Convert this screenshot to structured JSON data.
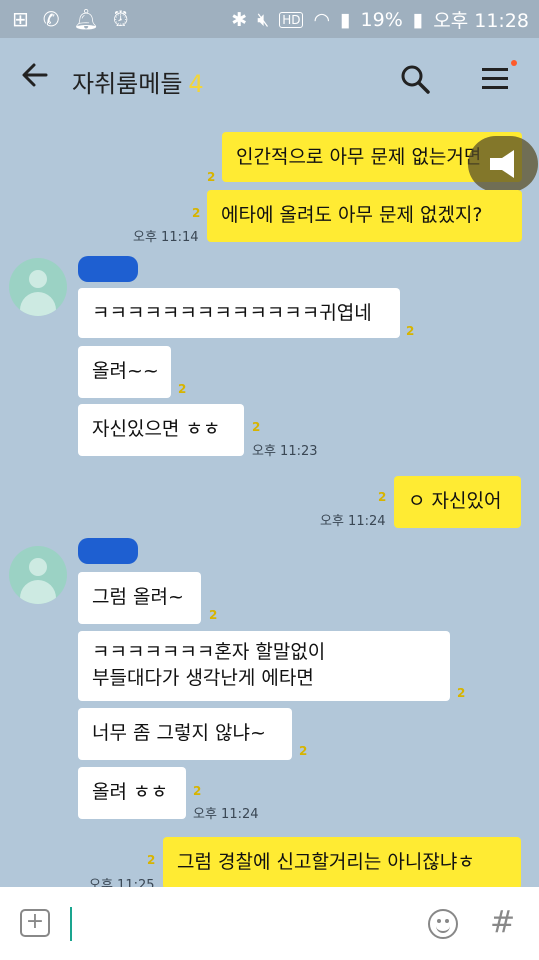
{
  "status_bar": {
    "battery": "19%",
    "time": "오후 11:28",
    "hd_label": "HD"
  },
  "header": {
    "title": "자취룸메들",
    "member_count": "4"
  },
  "messages": [
    {
      "side": "me",
      "text": "인간적으로 아무 문제 없는거면",
      "unread": "2"
    },
    {
      "side": "me",
      "text": "에타에 올려도 아무 문제 없겠지?",
      "unread": "2",
      "time": "오후 11:14"
    },
    {
      "side": "you",
      "text": "ㅋㅋㅋㅋㅋㅋㅋㅋㅋㅋㅋㅋㅋ귀엽네",
      "unread": "2"
    },
    {
      "side": "you",
      "text": "올려~~",
      "unread": "2"
    },
    {
      "side": "you",
      "text": "자신있으면 ㅎㅎ",
      "unread": "2",
      "time": "오후 11:23"
    },
    {
      "side": "me",
      "text": "ㅇ 자신있어",
      "unread": "2",
      "time": "오후 11:24"
    },
    {
      "side": "you",
      "text": "그럼 올려~",
      "unread": "2"
    },
    {
      "side": "you",
      "line1": "ㅋㅋㅋㅋㅋㅋㅋ혼자 할말없이",
      "line2": "부들대다가 생각난게 에타면",
      "unread": "2"
    },
    {
      "side": "you",
      "text": "너무 좀 그렇지 않냐~",
      "unread": "2"
    },
    {
      "side": "you",
      "text": "올려 ㅎㅎ",
      "unread": "2",
      "time": "오후 11:24"
    },
    {
      "side": "me",
      "text": "그럼 경찰에 신고할거리는 아니잖냐ㅎ",
      "unread": "2",
      "time": "오후 11:25"
    }
  ],
  "input": {
    "hash_label": "#"
  },
  "colors": {
    "background": "#b2c7d9",
    "my_bubble": "#ffeb33",
    "other_bubble": "#ffffff",
    "unread_count": "#d7b400",
    "name_redaction": "#1e5fd1"
  }
}
